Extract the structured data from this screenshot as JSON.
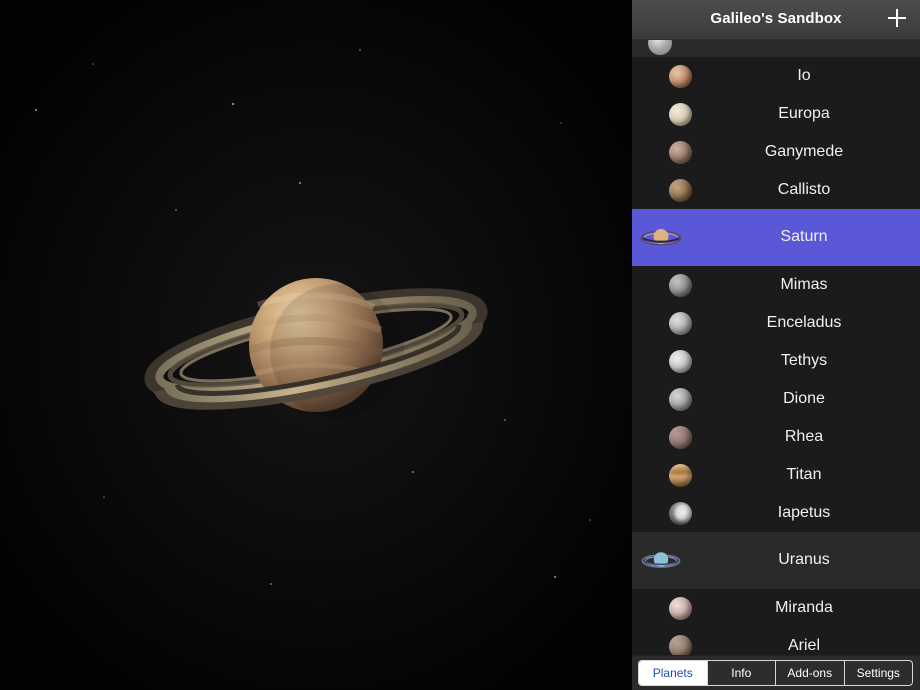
{
  "app": {
    "title": "Galileo's Sandbox",
    "selected_tab": "Planets",
    "selected_body": "Saturn"
  },
  "header": {
    "title": "Galileo's Sandbox",
    "add_icon": "plus-icon"
  },
  "bodies": [
    {
      "label": "Io",
      "type": "moon",
      "icon": "io-moon-icon",
      "color": "#9b6b4a",
      "selected": false
    },
    {
      "label": "Europa",
      "type": "moon",
      "icon": "europa-moon-icon",
      "color": "#d8cdb6",
      "selected": false
    },
    {
      "label": "Ganymede",
      "type": "moon",
      "icon": "ganymede-moon-icon",
      "color": "#8a6a55",
      "selected": false
    },
    {
      "label": "Callisto",
      "type": "moon",
      "icon": "callisto-moon-icon",
      "color": "#7f6044",
      "selected": false
    },
    {
      "label": "Saturn",
      "type": "planet",
      "icon": "saturn-icon",
      "color": "#d9b08a",
      "selected": true
    },
    {
      "label": "Mimas",
      "type": "moon",
      "icon": "mimas-moon-icon",
      "color": "#7d7d7d",
      "selected": false
    },
    {
      "label": "Enceladus",
      "type": "moon",
      "icon": "enceladus-moon-icon",
      "color": "#9a9a9a",
      "selected": false
    },
    {
      "label": "Tethys",
      "type": "moon",
      "icon": "tethys-moon-icon",
      "color": "#b6b6b6",
      "selected": false
    },
    {
      "label": "Dione",
      "type": "moon",
      "icon": "dione-moon-icon",
      "color": "#8e8e8e",
      "selected": false
    },
    {
      "label": "Rhea",
      "type": "moon",
      "icon": "rhea-moon-icon",
      "color": "#8f746d",
      "selected": false
    },
    {
      "label": "Titan",
      "type": "moon",
      "icon": "titan-moon-icon",
      "color": "#b48a55",
      "selected": false
    },
    {
      "label": "Iapetus",
      "type": "moon",
      "icon": "iapetus-moon-icon",
      "color": "#d7d7d7",
      "selected": false
    },
    {
      "label": "Uranus",
      "type": "planet",
      "icon": "uranus-icon",
      "color": "#8fc2d8",
      "selected": false
    },
    {
      "label": "Miranda",
      "type": "moon",
      "icon": "miranda-moon-icon",
      "color": "#b99b8f",
      "selected": false
    },
    {
      "label": "Ariel",
      "type": "moon",
      "icon": "ariel-moon-icon",
      "color": "#8c7a6e",
      "selected": false
    }
  ],
  "tabs": [
    {
      "label": "Planets",
      "active": true
    },
    {
      "label": "Info",
      "active": false
    },
    {
      "label": "Add-ons",
      "active": false
    },
    {
      "label": "Settings",
      "active": false
    }
  ],
  "colors": {
    "selection": "#5a58d6",
    "sidebar": "#1a1a1a",
    "planet_row": "#2a2a2a",
    "tab_active_text": "#1e4bb7"
  }
}
